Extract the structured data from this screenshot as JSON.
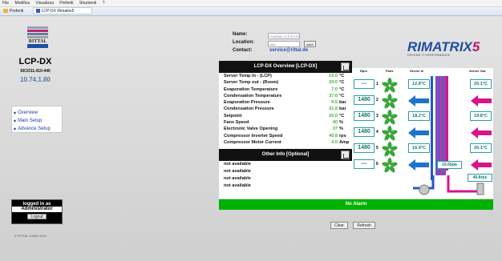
{
  "browser": {
    "menu": [
      "File",
      "Modifica",
      "Visualizza",
      "Preferiti",
      "Strumenti",
      "?"
    ],
    "favorites_label": "Preferiti",
    "tab_title": "LCP-DX Rimatrix5"
  },
  "left": {
    "logo_text": "RITTAL",
    "model": "LCP-DX",
    "serial": "SK3311.410-440",
    "ip": "10.74.1.80",
    "nav": [
      "Overview",
      "Main Setup",
      "Advance Setup"
    ],
    "login_status": "logged in as",
    "login_user": "Administrator",
    "logout_label": "Logout",
    "copyright": "© RITTAL GmbH 2012"
  },
  "header": {
    "name_label": "Name:",
    "name_value": "PostRate LCP-DX RIMA",
    "location_label": "Location:",
    "location_value": "Italy",
    "save_label": "save",
    "contact_label": "Contact:",
    "contact_value": "service@rittal.de",
    "brand_main": "RIMATRIX",
    "brand_5": "5",
    "brand_tagline": "DRIVING IT-PERFORMANCE"
  },
  "overview": {
    "title": "LCP-DX Overview [LCP-DX]",
    "rows": [
      {
        "label": "Server Temp In - (LCP)",
        "value": "15.0",
        "unit": "°C"
      },
      {
        "label": "Server Temp out - (Room)",
        "value": "20.0",
        "unit": "°C"
      },
      {
        "label": "Evaporation Temperature",
        "value": "7.0",
        "unit": "°C"
      },
      {
        "label": "Condensation Temperature",
        "value": "37.6",
        "unit": "°C"
      },
      {
        "label": "Evaporation Pressure",
        "value": "9.5",
        "unit": "bar"
      },
      {
        "label": "Condensation Pressure",
        "value": "21.8",
        "unit": "bar"
      },
      {
        "label": "Setpoint",
        "value": "20.0",
        "unit": "°C"
      },
      {
        "label": "Fans Speed",
        "value": "40",
        "unit": "%"
      },
      {
        "label": "Electronic Valve Opening",
        "value": "37",
        "unit": "%"
      },
      {
        "label": "Compressor Inverter Speed",
        "value": "40.8",
        "unit": "rps"
      },
      {
        "label": "Compressor Motor Current",
        "value": "4.5",
        "unit": "Amp"
      }
    ],
    "other_title": "Other Info [Optional]",
    "other_rows": [
      "not available",
      "not available",
      "not available",
      "not available"
    ]
  },
  "diagram": {
    "headers": {
      "rpm": "Rpm",
      "fans": "Fans",
      "server_in": "Server In",
      "server_out": "Server Out"
    },
    "fans": [
      {
        "rpm": "---",
        "num": "1",
        "temp_in": "12.8°C",
        "temp_out": "20.1°C"
      },
      {
        "rpm": "1480",
        "num": "2",
        "temp_in": "",
        "temp_out": ""
      },
      {
        "rpm": "1480",
        "num": "3",
        "temp_in": "18.2°C",
        "temp_out": "19.8°C"
      },
      {
        "rpm": "1480",
        "num": "4",
        "temp_in": "",
        "temp_out": ""
      },
      {
        "rpm": "1480",
        "num": "5",
        "temp_in": "16.9°C",
        "temp_out": "20.1°C"
      },
      {
        "rpm": "---",
        "num": "6",
        "temp_in": "",
        "temp_out": ""
      }
    ],
    "pressure_low": "19.5bpa",
    "pressure_high": "40.8rps"
  },
  "footer": {
    "alarm": "No Alarm",
    "clear_label": "Clear",
    "refresh_label": "Refresh"
  },
  "colors": {
    "green": "#00b200",
    "blue_arrow": "#1f73c9",
    "pink_arrow": "#d8148c",
    "fan_green": "#3aa63a"
  }
}
